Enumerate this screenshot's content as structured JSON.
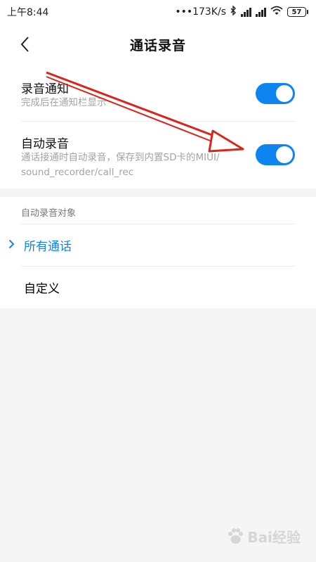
{
  "status_bar": {
    "time": "上午8:44",
    "network_speed": "•••173K/s",
    "bluetooth_icon": "bluetooth-icon",
    "battery": "57"
  },
  "header": {
    "title": "通话录音",
    "back_icon": "chevron-left-icon"
  },
  "settings": [
    {
      "title": "录音通知",
      "description": "完成后在通知栏显示",
      "enabled": true
    },
    {
      "title": "自动录音",
      "description_line1": "通话接通时自动录音，保存到内置SD卡的MIUI/",
      "description_line2": "sound_recorder/call_rec",
      "enabled": true
    }
  ],
  "auto_record_target": {
    "section_label": "自动录音对象",
    "options": [
      {
        "label": "所有通话",
        "selected": true
      },
      {
        "label": "自定义",
        "selected": false
      }
    ]
  },
  "watermark": {
    "text": "Bai经验"
  },
  "colors": {
    "accent": "#0d84f0",
    "annotation_arrow": "#d9261c",
    "background": "#f5f5f5"
  }
}
